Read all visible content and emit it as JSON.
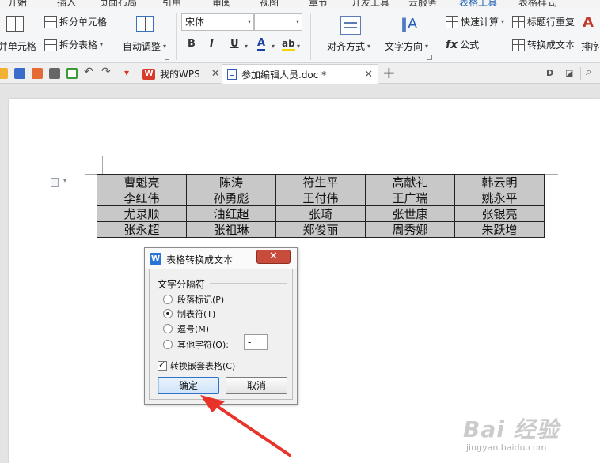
{
  "menu_tabs": [
    "开始",
    "插入",
    "页面布局",
    "引用",
    "审阅",
    "视图",
    "章节",
    "开发工具",
    "云服务",
    "表格工具",
    "表格样式"
  ],
  "ribbon": {
    "merge_label": "合并单元格",
    "split_cell_label": "拆分单元格",
    "split_table_label": "拆分表格",
    "autofit_label": "自动调整",
    "font_name": "宋体",
    "font_size": "",
    "bold": "B",
    "italic": "I",
    "underline": "U",
    "font_color": "A",
    "highlight": "ab",
    "align_label": "对齐方式",
    "text_dir_label": "文字方向",
    "quick_calc_label": "快速计算",
    "formula_label": "公式",
    "header_repeat_label": "标题行重复",
    "convert_text_label": "转换成文本",
    "sort_label": "排序"
  },
  "tabs": [
    {
      "label": "我的WPS"
    },
    {
      "label": "参加编辑人员.doc *"
    }
  ],
  "table": [
    [
      "曹魁亮",
      "陈涛",
      "符生平",
      "高献礼",
      "韩云明"
    ],
    [
      "李红伟",
      "孙勇彪",
      "王付伟",
      "王广瑞",
      "姚永平"
    ],
    [
      "尤录顺",
      "油红超",
      "张琦",
      "张世康",
      "张银亮"
    ],
    [
      "张永超",
      "张祖琳",
      "郑俊丽",
      "周秀娜",
      "朱跃增"
    ]
  ],
  "dialog": {
    "title": "表格转换成文本",
    "group_label": "文字分隔符",
    "options": [
      {
        "label": "段落标记(P)",
        "selected": false
      },
      {
        "label": "制表符(T)",
        "selected": true
      },
      {
        "label": "逗号(M)",
        "selected": false
      },
      {
        "label": "其他字符(O):",
        "selected": false
      }
    ],
    "other_char_value": "-",
    "nested_label": "转换嵌套表格(C)",
    "nested_checked": true,
    "ok_label": "确定",
    "cancel_label": "取消",
    "close_glyph": "✕"
  },
  "watermark": {
    "brand": "Bai 经验",
    "url": "jingyan.baidu.com"
  },
  "colors": {
    "accent": "#1c5fb4",
    "annotation_arrow": "#e8332a",
    "dialog_close": "#c84c3c",
    "table_fill": "#c8c8c8"
  }
}
